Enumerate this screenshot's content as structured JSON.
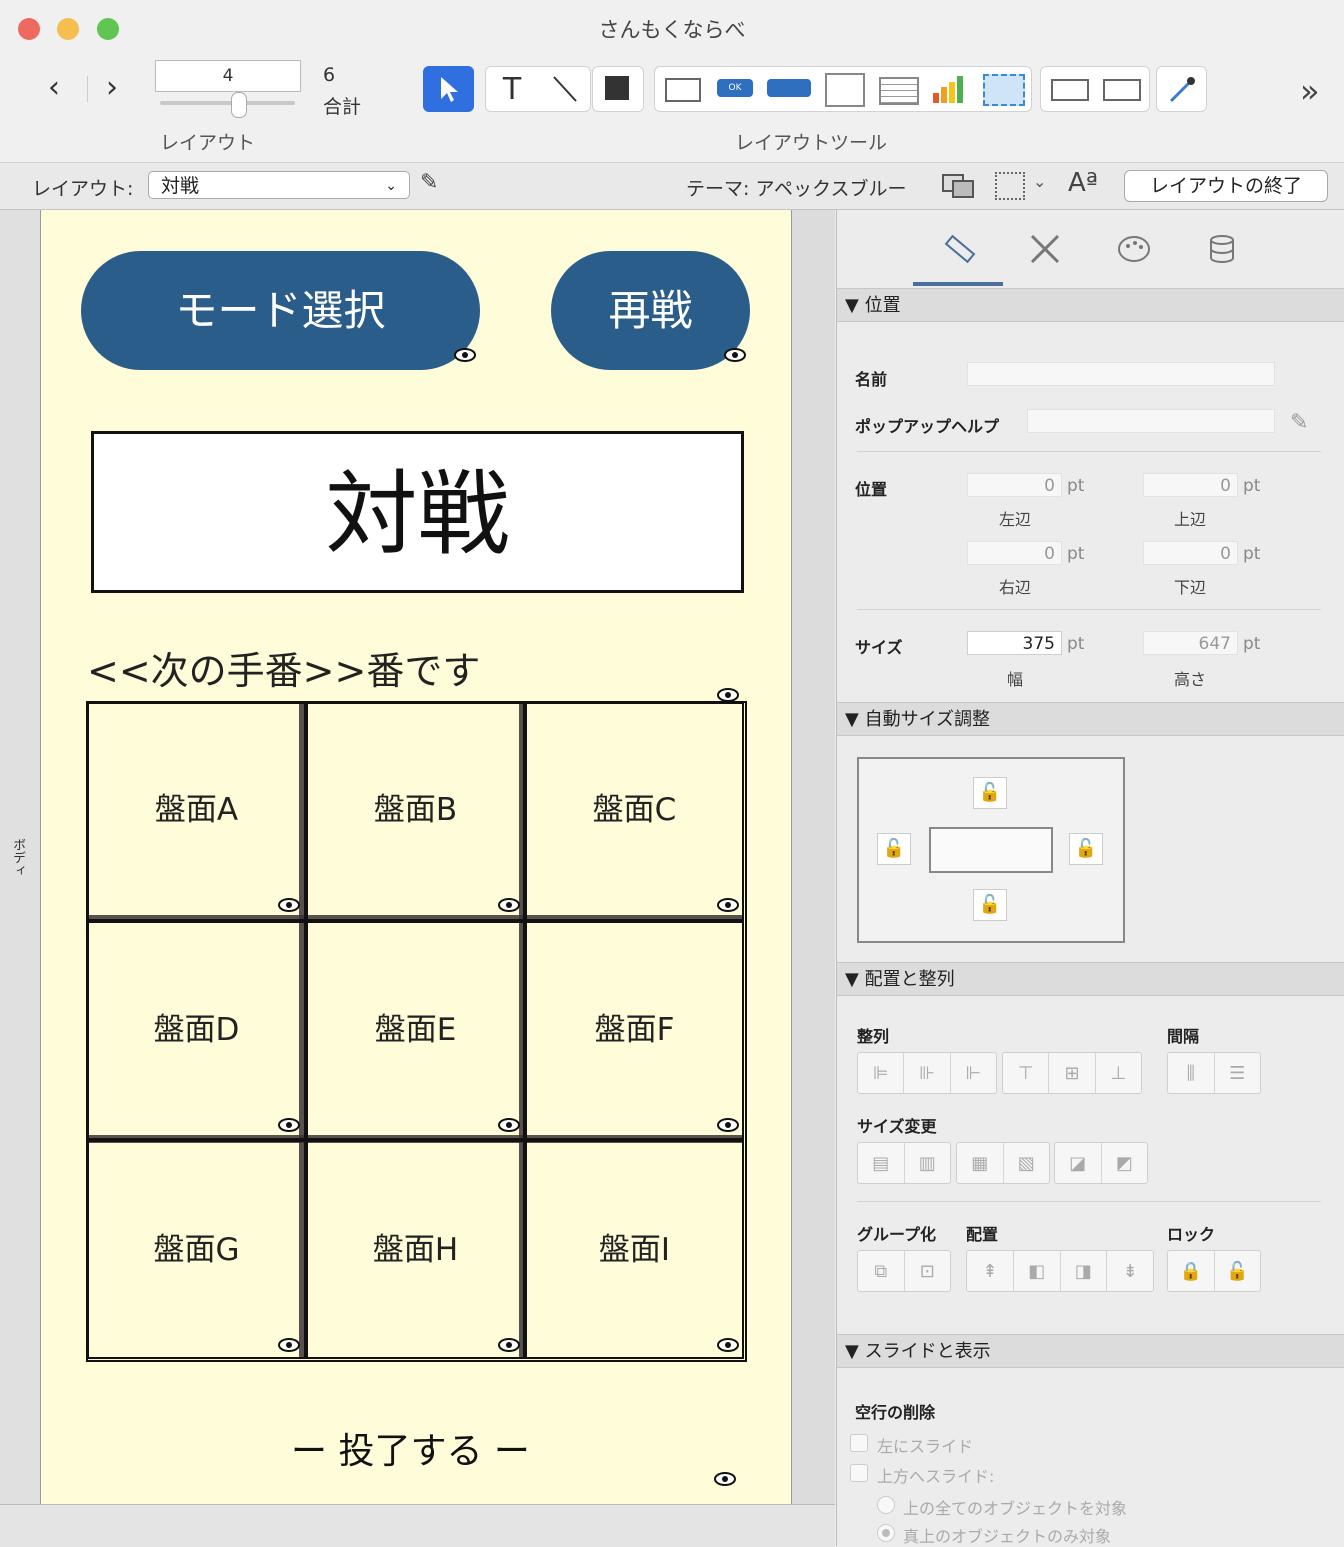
{
  "window": {
    "title": "さんもくならべ"
  },
  "toolbar": {
    "back": "‹",
    "forward": "›",
    "page_value": "4",
    "total_value": "6",
    "total_label": "合計",
    "layout_label": "レイアウト",
    "tools_label": "レイアウトツール",
    "overflow": "»"
  },
  "layoutbar": {
    "layout_label": "レイアウト:",
    "layout_value": "対戦",
    "theme_label": "テーマ: アペックスブルー",
    "font_icon_text": "Aª",
    "exit_button": "レイアウトの終了"
  },
  "gutter": {
    "label": "ボディ"
  },
  "canvas": {
    "mode_button": "モード選択",
    "rematch_button": "再戦",
    "title": "対戦",
    "turn_text": "<<次の手番>>番です",
    "cells": [
      "盤面A",
      "盤面B",
      "盤面C",
      "盤面D",
      "盤面E",
      "盤面F",
      "盤面G",
      "盤面H",
      "盤面I"
    ],
    "resign": "ー 投了する ー"
  },
  "inspector": {
    "section_position": "▼ 位置",
    "name_label": "名前",
    "name_value": "",
    "popup_help_label": "ポップアップヘルプ",
    "popup_help_value": "",
    "position_label": "位置",
    "left_value": "0",
    "top_value": "0",
    "right_value": "0",
    "bottom_value": "0",
    "unit": "pt",
    "left_label": "左辺",
    "top_label": "上辺",
    "right_label": "右辺",
    "bottom_label": "下辺",
    "size_label": "サイズ",
    "width_value": "375",
    "height_value": "647",
    "width_label": "幅",
    "height_label": "高さ",
    "section_autosize": "▼ 自動サイズ調整",
    "section_arrange": "▼ 配置と整列",
    "align_label": "整列",
    "spacing_label": "間隔",
    "resize_label": "サイズ変更",
    "group_label": "グループ化",
    "arrange_label": "配置",
    "lock_label": "ロック",
    "section_slide": "▼ スライドと表示",
    "remove_blank_label": "空行の削除",
    "slide_left": "左にスライド",
    "slide_up": "上方へスライド:",
    "all_objects": "上の全てのオブジェクトを対象",
    "only_above": "真上のオブジェクトのみ対象"
  },
  "colors": {
    "canvas_bg": "#fefcd9",
    "button_blue": "#2a5d89",
    "selected_tool": "#2f6fe0"
  }
}
